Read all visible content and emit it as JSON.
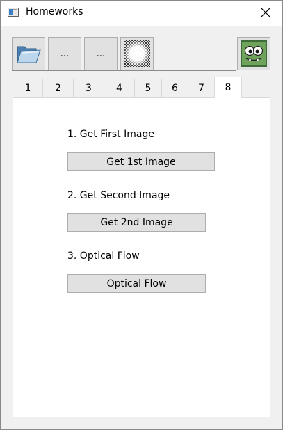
{
  "window": {
    "title": "Homeworks",
    "icon": "app-window-icon",
    "close_icon": "close-icon"
  },
  "toolbar": {
    "open_folder_icon": "open-folder-icon",
    "button2_label": "...",
    "button3_label": "...",
    "pattern_icon": "pattern-icon",
    "monster_icon": "monster-face-icon"
  },
  "tabs": [
    {
      "label": "1"
    },
    {
      "label": "2"
    },
    {
      "label": "3"
    },
    {
      "label": "4"
    },
    {
      "label": "5"
    },
    {
      "label": "6"
    },
    {
      "label": "7"
    },
    {
      "label": "8",
      "active": true
    }
  ],
  "panel": {
    "section1_label": "1. Get First Image",
    "button1_label": "Get 1st Image",
    "section2_label": "2. Get Second Image",
    "button2_label": "Get 2nd Image",
    "section3_label": "3. Optical Flow",
    "button3_label": "Optical Flow"
  }
}
